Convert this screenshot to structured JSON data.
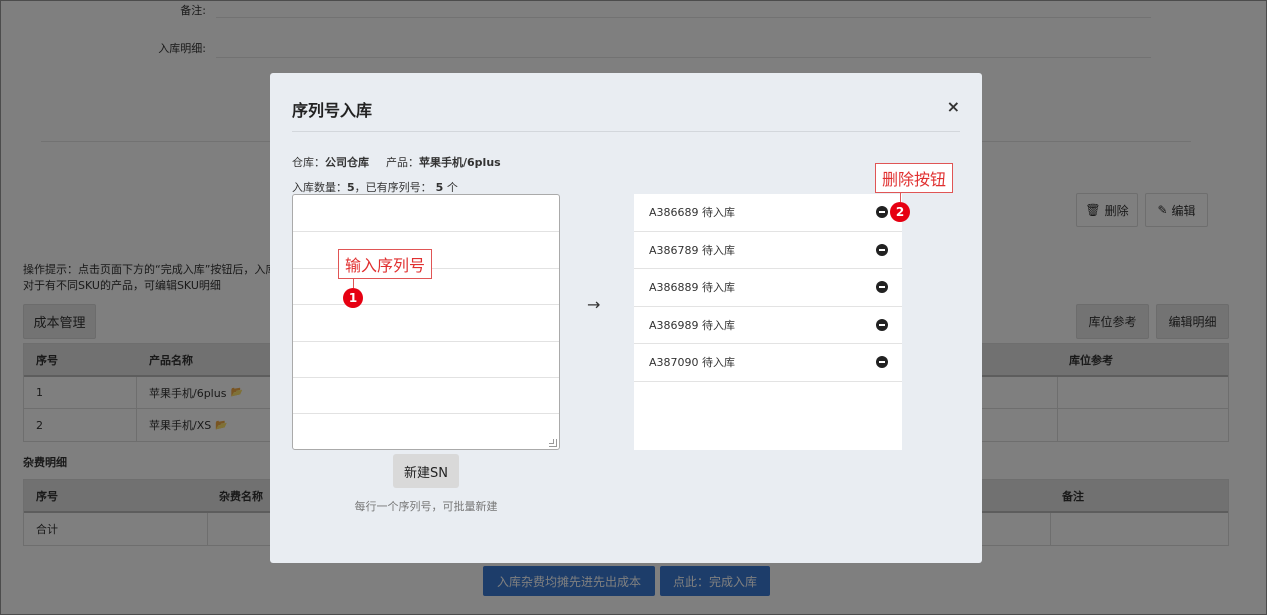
{
  "background": {
    "form": {
      "remark_label": "备注:",
      "detail_label": "入库明细:"
    },
    "actions": {
      "delete_label": "删除",
      "edit_label": "编辑"
    },
    "hint": {
      "line1": "操作提示：点击页面下方的“完成入库”按钮后，入库才",
      "line2": "对于有不同SKU的产品，可编辑SKU明细"
    },
    "cost_button": "成本管理",
    "location_ref_button": "库位参考",
    "edit_detail_button": "编辑明细",
    "product_table": {
      "headers": [
        "序号",
        "产品名称",
        "库位参考"
      ],
      "rows": [
        {
          "index": "1",
          "name": "苹果手机/6plus"
        },
        {
          "index": "2",
          "name": "苹果手机/XS"
        }
      ]
    },
    "fee_section_title": "杂费明细",
    "fee_table": {
      "headers": [
        "序号",
        "杂费名称",
        "备注"
      ],
      "total_label": "合计"
    },
    "bottom_buttons": {
      "allocate": "入库杂费均摊先进先出成本",
      "complete": "点此：完成入库"
    }
  },
  "modal": {
    "title": "序列号入库",
    "close": "×",
    "warehouse_label": "仓库：",
    "warehouse_value": "公司仓库",
    "product_label": "产品：",
    "product_value": "苹果手机/6plus",
    "qty_label": "入库数量：",
    "qty_value": "5",
    "existing_label": "，已有序列号：",
    "existing_value": "5",
    "existing_unit": "个",
    "new_sn_button": "新建SN",
    "note": "每行一个序列号，可批量新建",
    "arrow": "→",
    "serials": [
      {
        "text": "A386689 待入库"
      },
      {
        "text": "A386789 待入库"
      },
      {
        "text": "A386889 待入库"
      },
      {
        "text": "A386989 待入库"
      },
      {
        "text": "A387090 待入库"
      }
    ]
  },
  "annotations": {
    "input_label": "输入序列号",
    "input_marker": "1",
    "delete_label": "删除按钮",
    "delete_marker": "2"
  }
}
